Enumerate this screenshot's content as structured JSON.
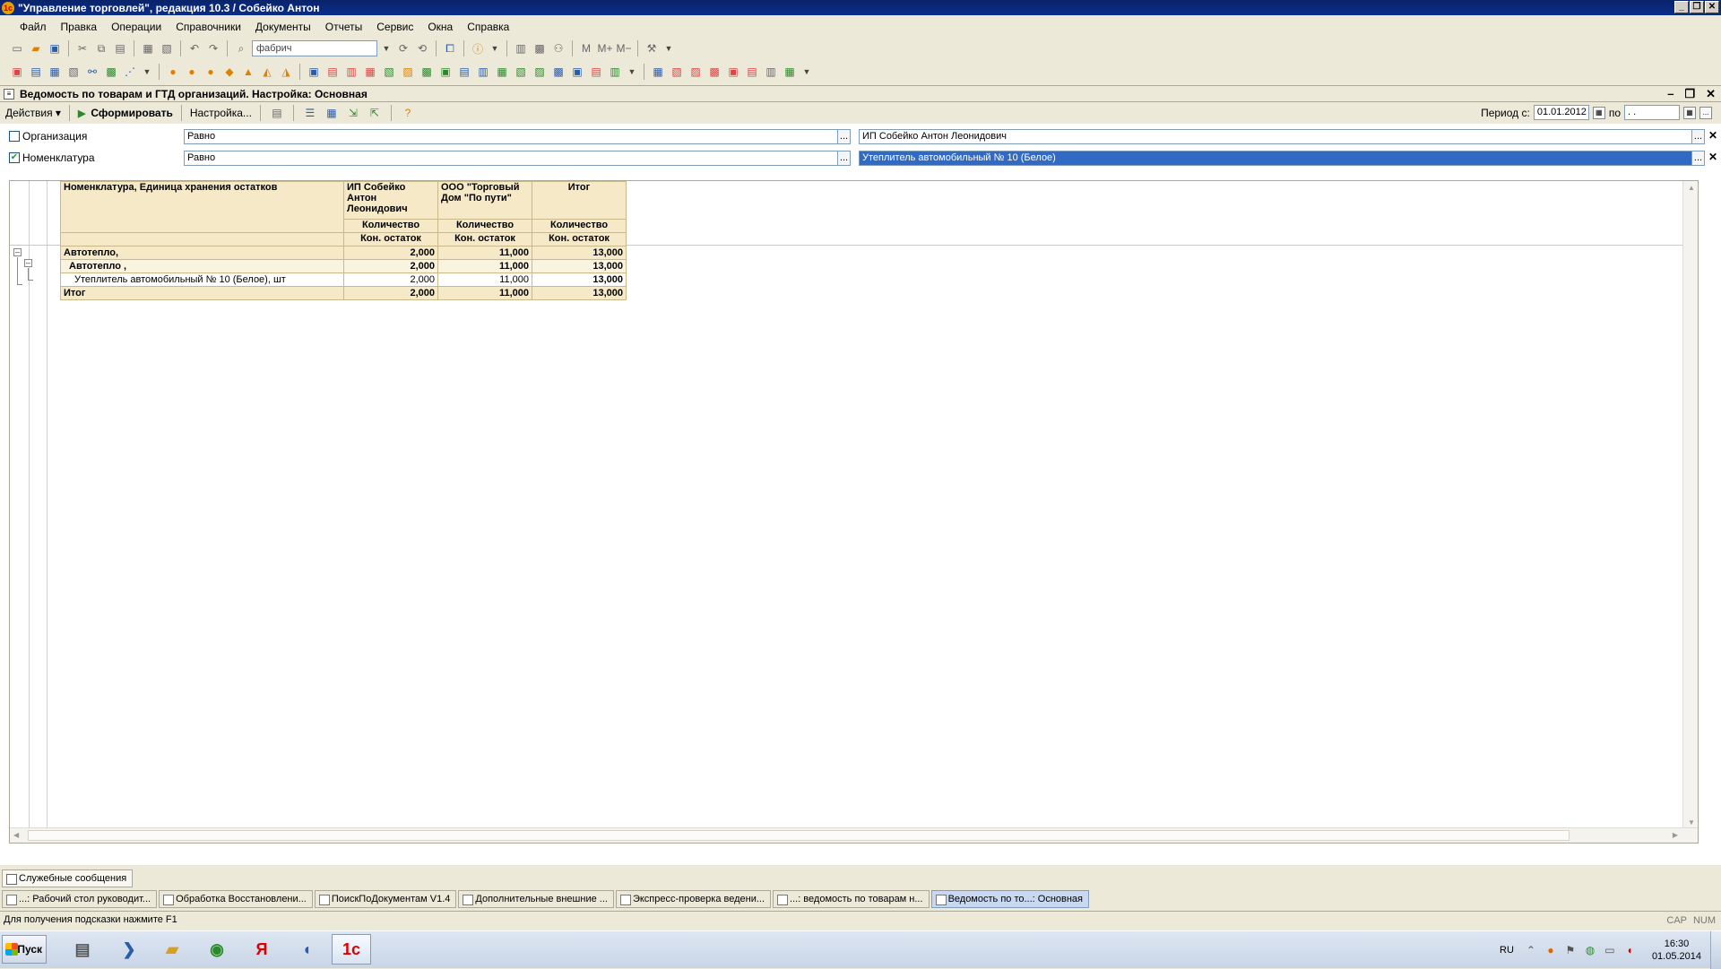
{
  "window": {
    "title": "\"Управление торговлей\", редакция 10.3 / Собейко Антон",
    "controls": {
      "minimize": "_",
      "restore": "❐",
      "close": "✕"
    }
  },
  "menu": [
    "Файл",
    "Правка",
    "Операции",
    "Справочники",
    "Документы",
    "Отчеты",
    "Сервис",
    "Окна",
    "Справка"
  ],
  "toolbar": {
    "search_value": "фабрич",
    "memory_labels": [
      "M",
      "M+",
      "M−"
    ]
  },
  "document": {
    "title": "Ведомость по товарам и ГТД организаций. Настройка: Основная",
    "actions_label": "Действия",
    "generate_label": "Сформировать",
    "settings_label": "Настройка...",
    "period_label": "Период с:",
    "period_from": "01.01.2012",
    "period_to_label": "по",
    "period_to": ". .",
    "dots_label": "...",
    "clear_label": "✕"
  },
  "filters": [
    {
      "label": "Организация",
      "checked": false,
      "condition": "Равно",
      "value": "ИП Собейко Антон Леонидович",
      "selected": false
    },
    {
      "label": "Номенклатура",
      "checked": true,
      "condition": "Равно",
      "value": "Утеплитель автомобильный № 10 (Белое)",
      "selected": true
    }
  ],
  "report": {
    "header": {
      "col0": "Номенклатура, Единица хранения остатков",
      "col1": "ИП Собейко Антон Леонидович",
      "col2": "ООО \"Торговый Дом \"По пути\"",
      "col3": "Итог",
      "sub1": "Количество",
      "sub2": "Кон. остаток"
    },
    "rows": [
      {
        "name": "Автотепло,",
        "c1": "2,000",
        "c2": "11,000",
        "c3": "13,000",
        "level": 1
      },
      {
        "name": "Автотепло ,",
        "c1": "2,000",
        "c2": "11,000",
        "c3": "13,000",
        "level": 2
      },
      {
        "name": "Утеплитель автомобильный № 10 (Белое), шт",
        "c1": "2,000",
        "c2": "11,000",
        "c3": "13,000",
        "level": 3
      }
    ],
    "total": {
      "name": "Итог",
      "c1": "2,000",
      "c2": "11,000",
      "c3": "13,000"
    }
  },
  "service_messages": "Служебные сообщения",
  "window_tabs": [
    "...: Рабочий стол руководит...",
    "Обработка Восстановлени...",
    "ПоискПоДокументам V1.4",
    "Дополнительные внешние ...",
    "Экспресс-проверка ведени...",
    "...: ведомость по товарам н...",
    "Ведомость по то...: Основная"
  ],
  "active_tab_index": 6,
  "status": {
    "hint": "Для получения подсказки нажмите F1",
    "cap": "CAP",
    "num": "NUM"
  },
  "os_taskbar": {
    "start_label": "Пуск",
    "lang": "RU",
    "time": "16:30",
    "date": "01.05.2014"
  }
}
